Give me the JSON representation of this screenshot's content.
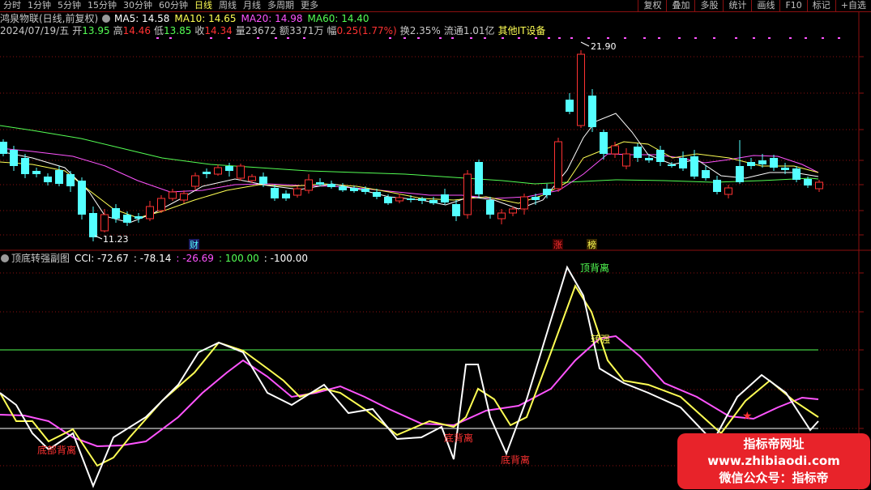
{
  "toolbar": {
    "tabs": [
      {
        "label": "分时",
        "active": false
      },
      {
        "label": "1分钟",
        "active": false
      },
      {
        "label": "5分钟",
        "active": false
      },
      {
        "label": "15分钟",
        "active": false
      },
      {
        "label": "30分钟",
        "active": false
      },
      {
        "label": "60分钟",
        "active": false
      },
      {
        "label": "日线",
        "active": true
      },
      {
        "label": "周线",
        "active": false
      },
      {
        "label": "月线",
        "active": false
      },
      {
        "label": "多周期",
        "active": false
      },
      {
        "label": "更多",
        "active": false
      }
    ],
    "right_buttons": [
      "复权",
      "叠加",
      "多股",
      "统计",
      "画线",
      "F10",
      "标记",
      "+自选"
    ]
  },
  "colors": {
    "up": "#ff3232",
    "down": "#54ffff",
    "ma5": "#ffffff",
    "ma10": "#ffff54",
    "ma20": "#ff54ff",
    "ma60": "#54ff54",
    "grid": "#8b1010",
    "label": "#c8c8c8"
  },
  "main_panel": {
    "stock_title": "鸿泉物联(日线,前复权)",
    "ma_labels": [
      {
        "text": "MA5: 14.58",
        "color": "#ffffff"
      },
      {
        "text": "MA10: 14.65",
        "color": "#ffff54"
      },
      {
        "text": "MA20: 14.98",
        "color": "#ff54ff"
      },
      {
        "text": "MA60: 14.40",
        "color": "#54ff54"
      }
    ],
    "info_items": [
      {
        "text": "2024/07/19/五",
        "color": "#c8c8c8"
      },
      {
        "text": "开",
        "color": "#c8c8c8"
      },
      {
        "text": "13.95",
        "color": "#54ff54"
      },
      {
        "text": "高",
        "color": "#c8c8c8"
      },
      {
        "text": "14.46",
        "color": "#ff3232"
      },
      {
        "text": "低",
        "color": "#c8c8c8"
      },
      {
        "text": "13.85",
        "color": "#54ff54"
      },
      {
        "text": "收",
        "color": "#c8c8c8"
      },
      {
        "text": "14.34",
        "color": "#ff3232"
      },
      {
        "text": "量",
        "color": "#c8c8c8"
      },
      {
        "text": "23672",
        "color": "#c8c8c8"
      },
      {
        "text": "额",
        "color": "#c8c8c8"
      },
      {
        "text": "3371万",
        "color": "#c8c8c8"
      },
      {
        "text": "幅",
        "color": "#c8c8c8"
      },
      {
        "text": "0.25(1.77%)",
        "color": "#ff3232"
      },
      {
        "text": "换2.35%",
        "color": "#c8c8c8"
      },
      {
        "text": "流通1.01亿",
        "color": "#c8c8c8"
      },
      {
        "text": "其他IT设备",
        "color": "#ffff54"
      }
    ],
    "high_label": "21.90",
    "low_label": "11.23",
    "event_markers": [
      {
        "text": "财",
        "color": "#54ffff",
        "bg": "#1a1a60"
      },
      {
        "text": "涨",
        "color": "#ff3232",
        "bg": "#3a0000"
      },
      {
        "text": "榜",
        "color": "#ffff54",
        "bg": "#3a2a00"
      }
    ]
  },
  "sub_panel": {
    "title": "顶底转强副图",
    "values": [
      {
        "text": "CCI: -72.67",
        "color": "#ffffff"
      },
      {
        "text": ": -78.14",
        "color": "#ffffff"
      },
      {
        "text": ": -26.69",
        "color": "#ff54ff"
      },
      {
        "text": ": 100.00",
        "color": "#54ff54"
      },
      {
        "text": ": -100.00",
        "color": "#ffffff"
      }
    ],
    "annotations": [
      {
        "text": "底部背离",
        "color": "#ff3232"
      },
      {
        "text": "底背离",
        "color": "#ff3232"
      },
      {
        "text": "底背离",
        "color": "#ff3232"
      },
      {
        "text": "顶背离",
        "color": "#54ff54"
      },
      {
        "text": "转强",
        "color": "#ffff54"
      }
    ]
  },
  "watermark": {
    "line1": "指标帝网址",
    "line2": "www.zhibiaodi.com",
    "line3": "微信公众号：指标帝"
  }
}
